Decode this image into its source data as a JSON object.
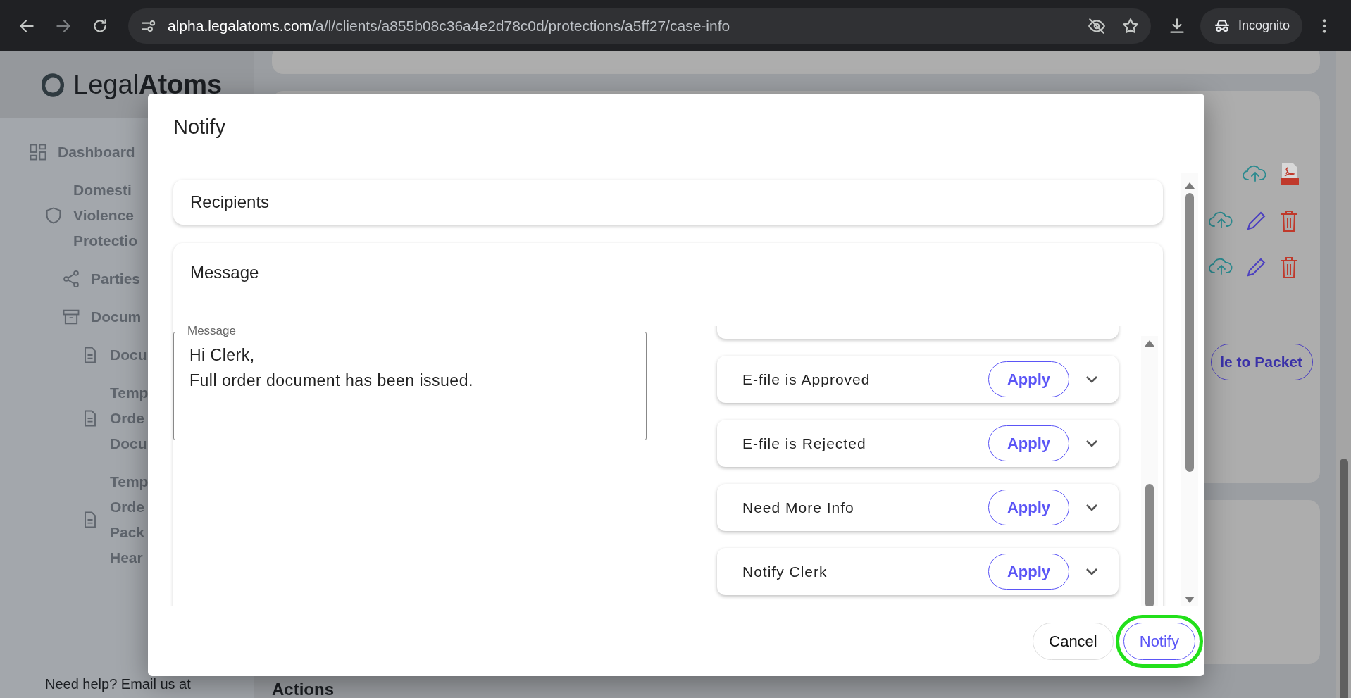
{
  "browser": {
    "url_host": "alpha.legalatoms.com",
    "url_path": "/a/l/clients/a855b08c36a4e2d78c0d/protections/a5ff27/case-info",
    "profile": "Incognito"
  },
  "sidebar": {
    "logo": {
      "light": "Legal",
      "bold": "Atoms"
    },
    "items": [
      {
        "kind": "dashboard",
        "lines": [
          "Dashboard"
        ]
      },
      {
        "kind": "shield",
        "lines": [
          "Domesti",
          "Violence",
          "Protectio"
        ],
        "children": [
          {
            "kind": "share",
            "lines": [
              "Parties"
            ]
          },
          {
            "kind": "archive",
            "lines": [
              "Docum"
            ],
            "children": [
              {
                "kind": "doc",
                "lines": [
                  "Docu"
                ]
              },
              {
                "kind": "doc",
                "lines": [
                  "Temp",
                  "Orde",
                  "Docu"
                ]
              },
              {
                "kind": "doc",
                "lines": [
                  "Temp",
                  "Orde",
                  "Pack",
                  "Hear"
                ]
              }
            ]
          }
        ]
      }
    ],
    "help": "Need help? Email us at"
  },
  "main": {
    "document_rows": [
      {
        "actions": [
          {
            "kind": "upload"
          },
          {
            "kind": "pdf"
          }
        ]
      },
      {
        "actions": [
          {
            "kind": "upload"
          },
          {
            "kind": "edit"
          },
          {
            "kind": "delete"
          }
        ]
      },
      {
        "actions": [
          {
            "kind": "upload"
          },
          {
            "kind": "edit"
          },
          {
            "kind": "delete"
          }
        ]
      }
    ],
    "packet_button": "le to Packet",
    "section_heading": "Actions"
  },
  "modal": {
    "title": "Notify",
    "recipients_title": "Recipients",
    "message_title": "Message",
    "message_field": {
      "label": "Message",
      "value": "Hi Clerk,\nFull order document has been issued."
    },
    "templates": [
      {
        "name": "E-file is Approved",
        "button": "Apply",
        "expanded": false
      },
      {
        "name": "E-file is Rejected",
        "button": "Apply",
        "expanded": false
      },
      {
        "name": "Need More Info",
        "button": "Apply",
        "expanded": false
      },
      {
        "name": "Notify Clerk",
        "button": "Apply",
        "expanded": false
      }
    ],
    "buttons": [
      {
        "label": "Cancel",
        "kind": "plain",
        "highlighted": false
      },
      {
        "label": "Notify",
        "kind": "outline",
        "highlighted": true
      }
    ]
  }
}
